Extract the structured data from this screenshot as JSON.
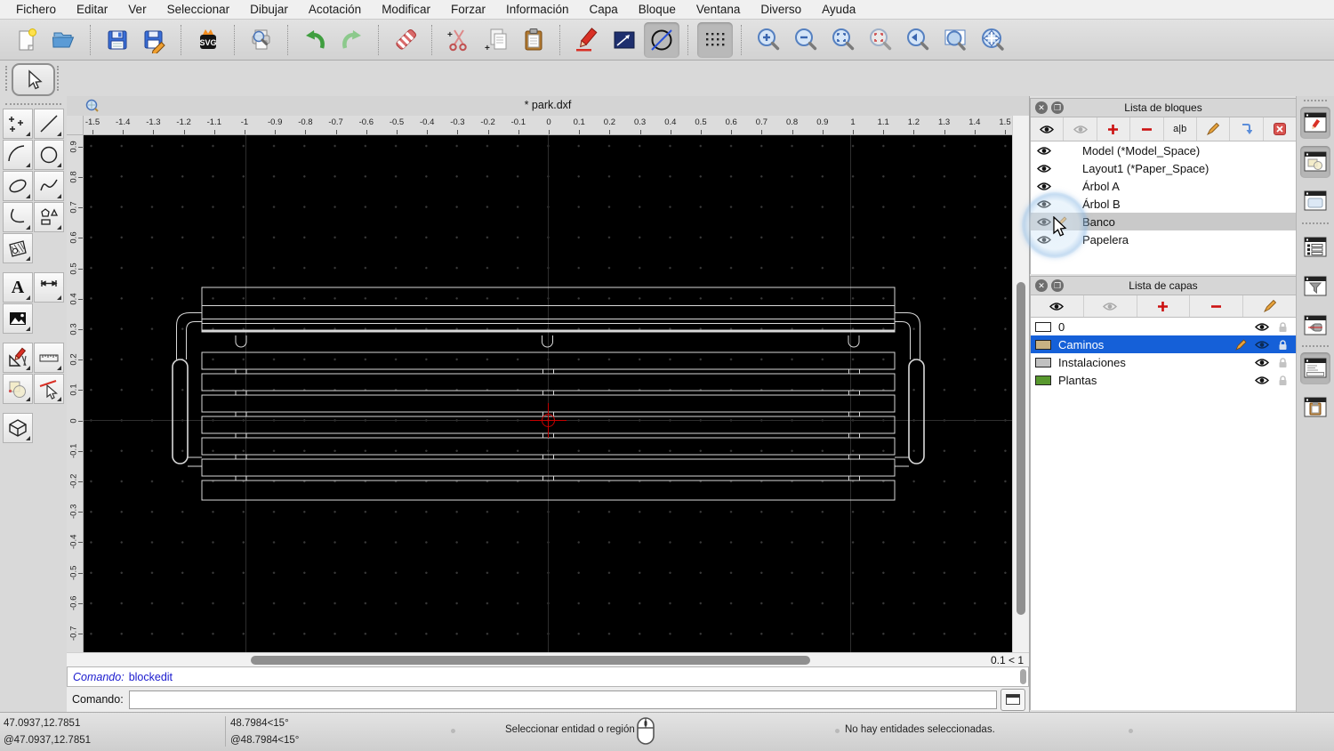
{
  "menu": {
    "items": [
      "Fichero",
      "Editar",
      "Ver",
      "Seleccionar",
      "Dibujar",
      "Acotación",
      "Modificar",
      "Forzar",
      "Información",
      "Capa",
      "Bloque",
      "Ventana",
      "Diverso",
      "Ayuda"
    ]
  },
  "toolbar": {
    "icons": [
      "new-file",
      "open-file",
      "save",
      "save-as",
      "svg-export",
      "print-preview",
      "undo",
      "redo",
      "delete-selected",
      "cut",
      "copy",
      "paste",
      "draw-pencil",
      "polyline-arrow",
      "circle-line-mode",
      "grid-toggle",
      "zoom-in",
      "zoom-out",
      "zoom-auto",
      "zoom-select",
      "zoom-previous",
      "zoom-window",
      "zoom-pan"
    ],
    "svg_label": "SVG",
    "active_buttons": [
      "circle-line-mode",
      "grid-toggle"
    ]
  },
  "left_tools": {
    "icons": [
      "select-arrow",
      "points",
      "line",
      "arc",
      "circle",
      "ellipse",
      "spline",
      "polyline",
      "polygon",
      "hatch",
      "text",
      "dimension",
      "image",
      "modify",
      "measure",
      "trim",
      "delete-entity",
      "block"
    ],
    "text_tool_label": "A"
  },
  "document": {
    "title_display": "* park.dxf"
  },
  "rulers": {
    "x_ticks": [
      "-1.5",
      "-1.4",
      "-1.3",
      "-1.2",
      "-1.1",
      "-1",
      "-0.9",
      "-0.8",
      "-0.7",
      "-0.6",
      "-0.5",
      "-0.4",
      "-0.3",
      "-0.2",
      "-0.1",
      "0",
      "0.1",
      "0.2",
      "0.3",
      "0.4",
      "0.5",
      "0.6",
      "0.7",
      "0.8",
      "0.9",
      "1",
      "1.1",
      "1.2",
      "1.3",
      "1.4",
      "1.5"
    ],
    "y_ticks": [
      "0.9",
      "0.8",
      "0.7",
      "0.6",
      "0.5",
      "0.4",
      "0.3",
      "0.2",
      "0.1",
      "0",
      "-0.1",
      "-0.2",
      "-0.3",
      "-0.4",
      "-0.5",
      "-0.6",
      "-0.7"
    ]
  },
  "scroll": {
    "zoom_indicator": "0.1 < 1"
  },
  "command": {
    "history_label": "Comando:",
    "history_value": "blockedit",
    "prompt_label": "Comando:",
    "input_value": ""
  },
  "blocks_panel": {
    "title": "Lista de bloques",
    "toolbar_icons": [
      "show-all-eye",
      "hide-all-eye",
      "add-block",
      "remove-block",
      "rename-block",
      "edit-block",
      "insert-block",
      "delete-all"
    ],
    "rename_label": "a|b",
    "items": [
      {
        "name": "Model (*Model_Space)",
        "visible": true
      },
      {
        "name": "Layout1 (*Paper_Space)",
        "visible": true
      },
      {
        "name": "Árbol A",
        "visible": true
      },
      {
        "name": "Árbol B",
        "visible": true
      },
      {
        "name": "Banco",
        "visible": true,
        "selected": true,
        "editing": true
      },
      {
        "name": "Papelera",
        "visible": true
      }
    ]
  },
  "layers_panel": {
    "title": "Lista de capas",
    "toolbar_icons": [
      "show-all-eye",
      "hide-all-eye",
      "add-layer",
      "remove-layer",
      "edit-layer"
    ],
    "items": [
      {
        "name": "0",
        "color": "#ffffff",
        "visible": true,
        "locked": false
      },
      {
        "name": "Caminos",
        "color": "#c7b183",
        "visible": true,
        "locked": false,
        "selected": true,
        "editing": true
      },
      {
        "name": "Instalaciones",
        "color": "#c0c0c0",
        "visible": true,
        "locked": false
      },
      {
        "name": "Plantas",
        "color": "#58982e",
        "visible": true,
        "locked": false
      }
    ]
  },
  "statusbar": {
    "abs_coord": "47.0937,12.7851",
    "rel_coord": "@47.0937,12.7851",
    "abs_polar": "48.7984<15°",
    "rel_polar": "@48.7984<15°",
    "hint": "Seleccionar entidad o región",
    "selection_status": "No hay entidades seleccionadas."
  },
  "colors": {
    "selection_blue": "#1560d8",
    "crosshair_red": "#c40000",
    "canvas_line": "#d9d9d9"
  }
}
